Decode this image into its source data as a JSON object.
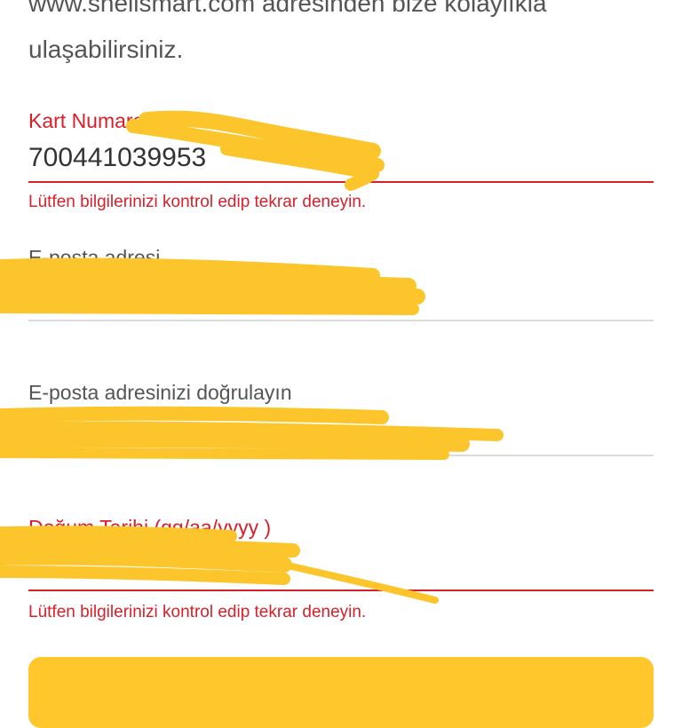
{
  "intro": {
    "line1": "www.shellsmart.com adresinden bize kolaylıkla",
    "line2": "ulaşabilirsiniz."
  },
  "card_number": {
    "label": "Kart Numarası",
    "value": "700441039953",
    "error": "Lütfen bilgilerinizi kontrol edip tekrar deneyin."
  },
  "email": {
    "label": "E-posta adresi",
    "value": ""
  },
  "email_confirm": {
    "label": "E-posta adresinizi doğrulayın",
    "value": ""
  },
  "birth_date": {
    "label": "Doğum Tarihi (gg/aa/yyyy )",
    "value": "",
    "error": "Lütfen bilgilerinizi kontrol edip tekrar deneyin."
  },
  "submit": {
    "label": ""
  },
  "colors": {
    "error": "#d8202a",
    "divider": "#dcdcdc",
    "accent": "#ffc72c",
    "redaction": "#fcc52c"
  }
}
